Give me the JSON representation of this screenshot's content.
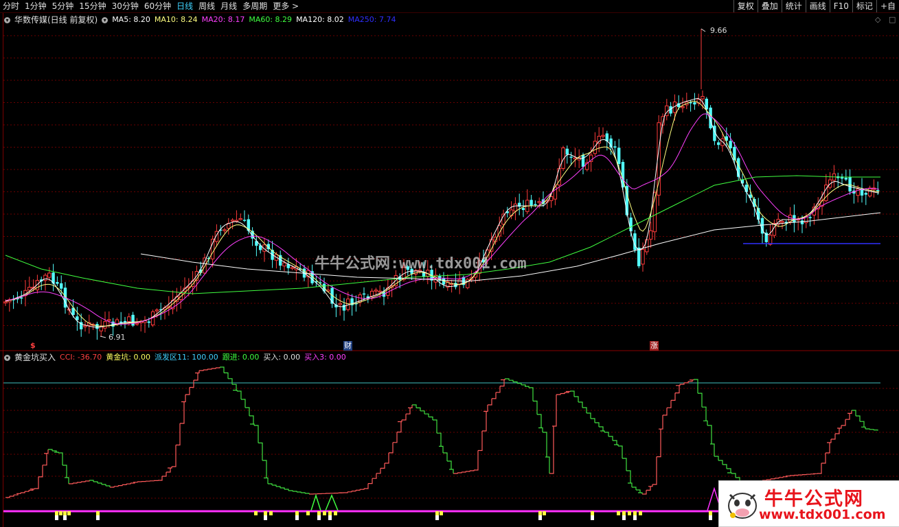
{
  "toolbar": {
    "periods": [
      "分时",
      "1分钟",
      "5分钟",
      "15分钟",
      "30分钟",
      "60分钟",
      "日线",
      "周线",
      "月线",
      "多周期",
      "更多 >"
    ],
    "active_period": "日线",
    "tools": [
      "复权",
      "叠加",
      "统计",
      "画线",
      "F10",
      "标记",
      "+自"
    ]
  },
  "main_chart": {
    "title": "华数传媒(日线 前复权)",
    "ma": [
      {
        "label": "MA5:",
        "value": "8.20",
        "color": "#ffffff"
      },
      {
        "label": "MA10:",
        "value": "8.24",
        "color": "#ffff80"
      },
      {
        "label": "MA20:",
        "value": "8.17",
        "color": "#ff40ff"
      },
      {
        "label": "MA60:",
        "value": "8.29",
        "color": "#40ff40"
      },
      {
        "label": "MA120:",
        "value": "8.02",
        "color": "#ffffff"
      },
      {
        "label": "MA250:",
        "value": "7.74",
        "color": "#2f2fff"
      }
    ],
    "high_label": "9.66",
    "low_label": "6.91",
    "markers": {
      "marker_1": "$",
      "marker_2": "财",
      "marker_3": "涨"
    },
    "watermark": "牛牛公式网:www.tdx001.com",
    "controls": {
      "diamond": "◇",
      "box": "□"
    }
  },
  "indicator": {
    "title": "黄金坑买入",
    "items": [
      {
        "label": "CCI:",
        "value": "-36.70",
        "color": "#ff4040"
      },
      {
        "label": "黄金坑:",
        "value": "0.00",
        "color": "#ffff60"
      },
      {
        "label": "派发区11:",
        "value": "100.00",
        "color": "#40d0ff"
      },
      {
        "label": "跟进:",
        "value": "0.00",
        "color": "#40ff40"
      },
      {
        "label": "买入:",
        "value": "0.00",
        "color": "#e0e0e0"
      },
      {
        "label": "买入3:",
        "value": "0.00",
        "color": "#ff40ff"
      }
    ]
  },
  "logo": {
    "title": "牛牛公式网",
    "url": "www.tdx001.com"
  },
  "colors": {
    "up": "#ff3c3c",
    "down": "#54ffff",
    "grid": "#6b0000",
    "cci_up": "#ff5a5a",
    "cci_down": "#40e040",
    "band": "#ff30ff",
    "ref": "#40c0c0"
  }
}
